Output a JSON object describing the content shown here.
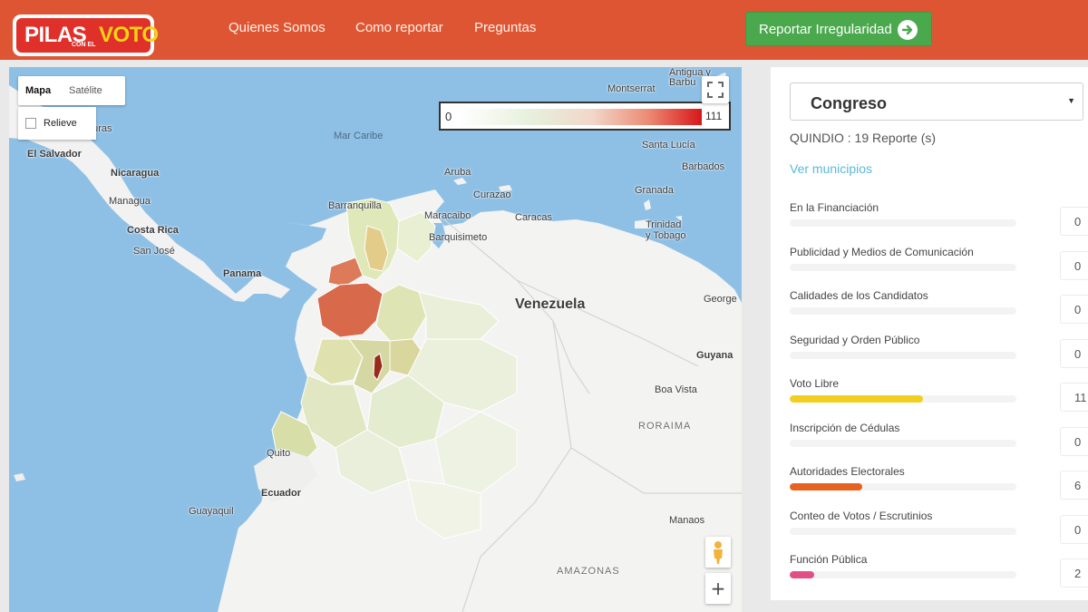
{
  "logo": {
    "pilas": "PILAS",
    "con_el": "CON EL",
    "voto": "VOTO"
  },
  "nav": {
    "items": [
      "Quienes Somos",
      "Como reportar",
      "Preguntas"
    ]
  },
  "report_button": {
    "label": "Reportar Irregularidad",
    "icon": "arrow-right-circle-icon",
    "color": "#4aa84d"
  },
  "map": {
    "type_control": {
      "map": "Mapa",
      "satellite": "Satélite"
    },
    "relief": "Relieve",
    "legend": {
      "min": "0",
      "max": "111"
    },
    "labels": {
      "honduras": "duras",
      "el_salvador": "El Salvador",
      "nicaragua": "Nicaragua",
      "managua": "Managua",
      "costa_rica": "Costa Rica",
      "san_jose": "San José",
      "panama": "Panama",
      "mar_caribe": "Mar Caribe",
      "barranquilla": "Barranquilla",
      "maracaibo": "Maracaibo",
      "barquisimeto": "Barquisimeto",
      "aruba": "Aruba",
      "curazao": "Curazao",
      "caracas": "Caracas",
      "venezuela": "Venezuela",
      "granada": "Granada",
      "trinidad": "Trinidad",
      "y_tobago": "y Tobago",
      "santa_lucia": "Santa Lucía",
      "barbados": "Barbados",
      "montserrat": "Montserrat",
      "antigua": "Antigua y",
      "barbuda": "Barbu",
      "georgetown": "George",
      "guyana": "Guyana",
      "boa_vista": "Boa Vista",
      "roraima": "RORAIMA",
      "quito": "Quito",
      "ecuador": "Ecuador",
      "guayaquil": "Guayaquil",
      "manaos": "Manaos",
      "amazonas": "AMAZONAS"
    }
  },
  "sidebar": {
    "select_value": "Congreso",
    "department_summary": "QUINDIO :  19 Reporte (s)",
    "municipalities_link": "Ver municipios",
    "categories": [
      {
        "name": "En la Financiación",
        "count": "0",
        "value": 0,
        "color": "#cccccc"
      },
      {
        "name": "Publicidad y Medios de Comunicación",
        "count": "0",
        "value": 0,
        "color": "#cccccc"
      },
      {
        "name": "Calidades de los Candidatos",
        "count": "0",
        "value": 0,
        "color": "#cccccc"
      },
      {
        "name": "Seguridad y Orden Público",
        "count": "0",
        "value": 0,
        "color": "#cccccc"
      },
      {
        "name": "Voto Libre",
        "count": "11",
        "value": 11,
        "color": "#f2cf1e"
      },
      {
        "name": "Inscripción de Cédulas",
        "count": "0",
        "value": 0,
        "color": "#cccccc"
      },
      {
        "name": "Autoridades Electorales",
        "count": "6",
        "value": 6,
        "color": "#e8621f"
      },
      {
        "name": "Conteo de Votos / Escrutinios",
        "count": "0",
        "value": 0,
        "color": "#cccccc"
      },
      {
        "name": "Función Pública",
        "count": "2",
        "value": 2,
        "color": "#e24f86"
      }
    ]
  }
}
